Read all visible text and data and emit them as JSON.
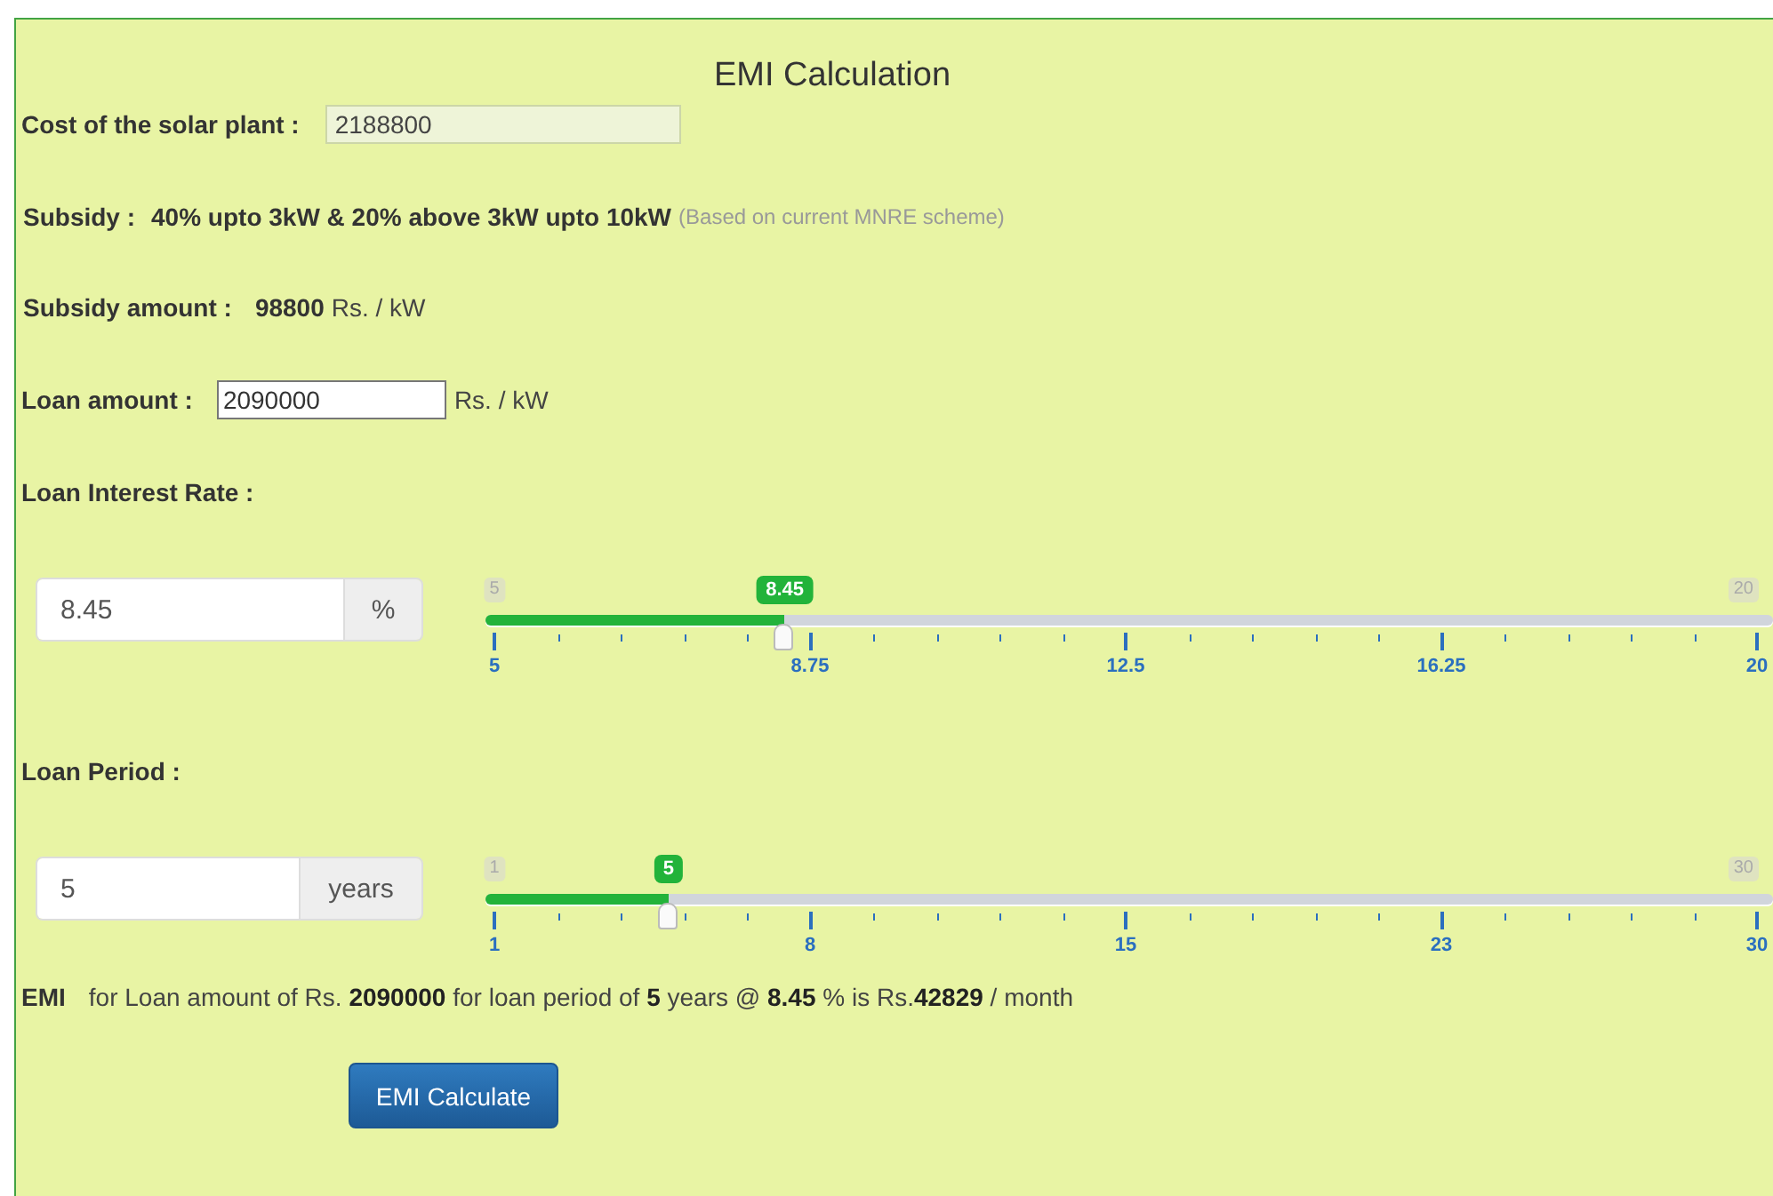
{
  "title": "EMI Calculation",
  "cost": {
    "label": "Cost of the solar plant :",
    "value": "2188800"
  },
  "subsidy": {
    "label": "Subsidy :",
    "text": "40% upto 3kW & 20% above 3kW upto 10kW",
    "note": "(Based on current MNRE scheme)"
  },
  "subsidy_amount": {
    "label": "Subsidy amount :",
    "value": "98800",
    "unit": "Rs. / kW"
  },
  "loan_amount": {
    "label": "Loan amount :",
    "value": "2090000",
    "unit": "Rs. / kW"
  },
  "sliders": [
    {
      "label": "Loan Interest Rate :",
      "value": "8.45",
      "unit": "%",
      "min": "5",
      "max": "20",
      "bubble": "8.45",
      "level": 0.23,
      "ticks": [
        "5",
        "8.75",
        "12.5",
        "16.25",
        "20"
      ]
    },
    {
      "label": "Loan Period :",
      "value": "5",
      "unit": "years",
      "min": "1",
      "max": "30",
      "bubble": "5",
      "level": 0.138,
      "ticks": [
        "1",
        "8",
        "15",
        "23",
        "30"
      ]
    }
  ],
  "result": {
    "label": "EMI",
    "sentence": "for Loan amount of Rs. **2090000** for loan period of **5** years @ **8.45** % is Rs.**42829** / month"
  },
  "button": "EMI Calculate"
}
